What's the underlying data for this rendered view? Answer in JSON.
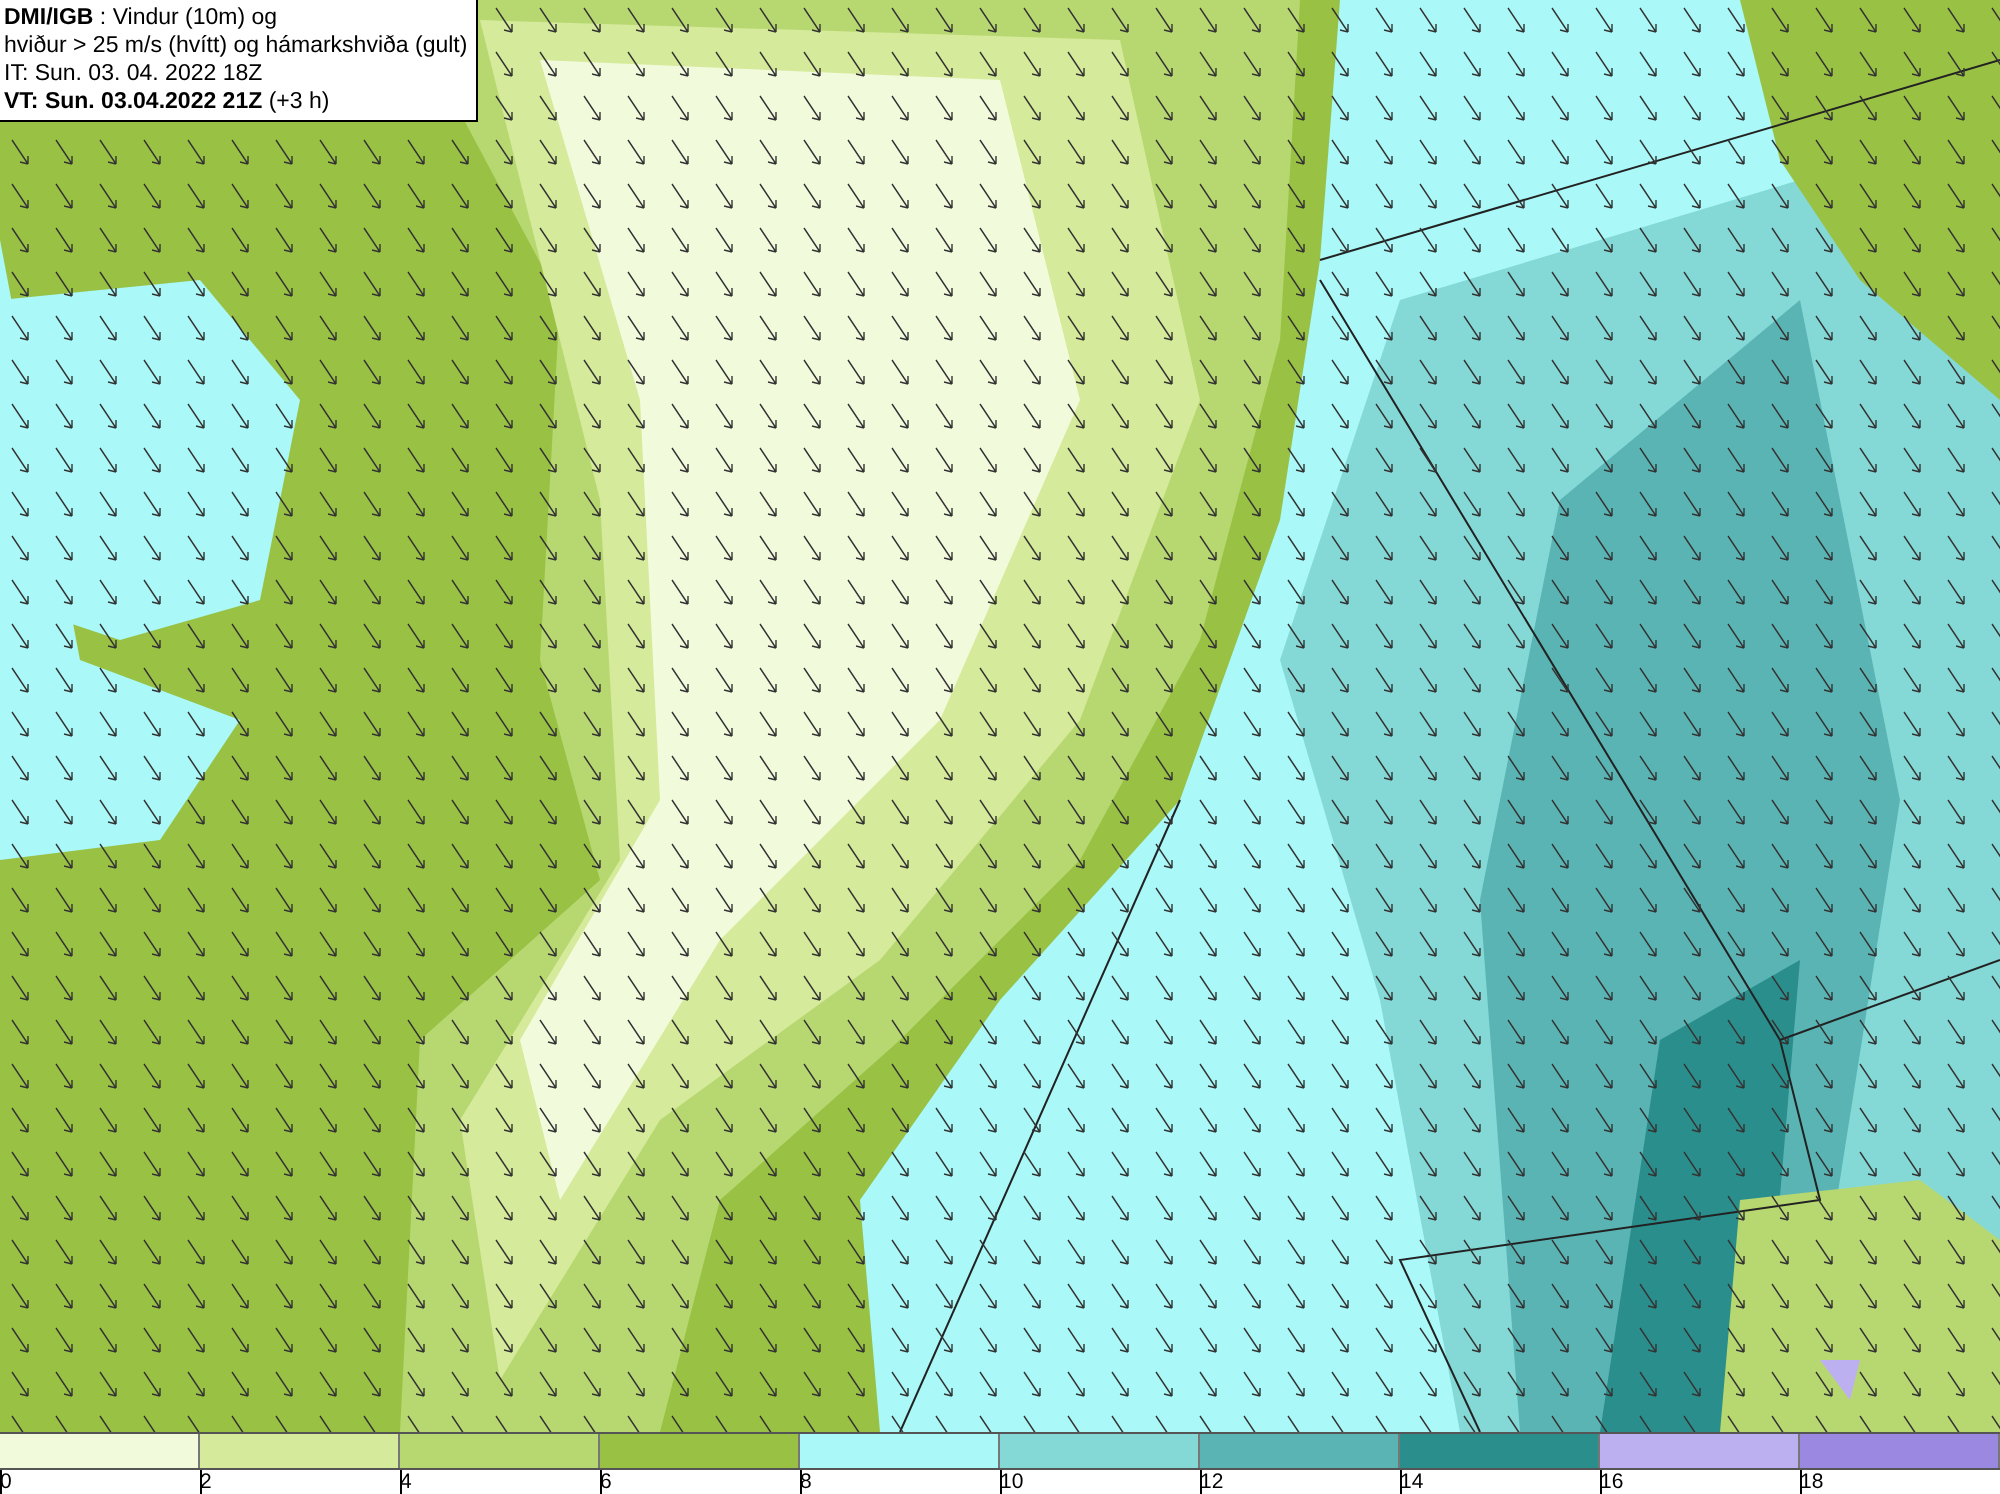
{
  "header": {
    "lines": [
      "**DMI/IGB** : Vindur (10m) og",
      "hviður > 25 m/s (hvítt) og hámarkshviða (gult)",
      "IT: Sun. 03. 04. 2022 18Z",
      "**VT: Sun. 03.04.2022 21Z** (+3 h)"
    ]
  },
  "legend": {
    "bins": [
      {
        "label": "0",
        "color": "#f2fadc"
      },
      {
        "label": "2",
        "color": "#d5ea9a"
      },
      {
        "label": "4",
        "color": "#b7d870"
      },
      {
        "label": "6",
        "color": "#99c144"
      },
      {
        "label": "8",
        "color": "#aaf8f8"
      },
      {
        "label": "10",
        "color": "#84d8d6"
      },
      {
        "label": "12",
        "color": "#5ab4b4"
      },
      {
        "label": "14",
        "color": "#2a8e8c"
      },
      {
        "label": "16",
        "color": "#bdb0f0"
      },
      {
        "label": "18",
        "color": "#9b88e0"
      }
    ]
  }
}
